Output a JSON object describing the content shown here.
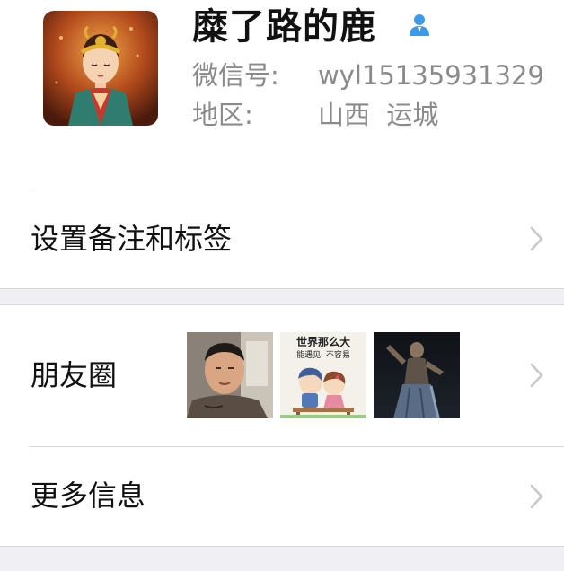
{
  "profile": {
    "name": "糜了路的鹿",
    "wechat_id_label": "微信号:",
    "wechat_id": "wyl15135931329",
    "region_label": "地区:",
    "region": "山西  运城",
    "avatar_icon": "avatar-monkey-king-child",
    "gender_icon": "person-icon"
  },
  "cells": {
    "remark_label": "设置备注和标签",
    "moments_label": "朋友圈",
    "more_label": "更多信息"
  },
  "moments": {
    "photo2_caption_line1": "世界那么大",
    "photo2_caption_line2": "能遇见, 不容易"
  },
  "colors": {
    "accent_blue": "#3d9ae8",
    "secondary_text": "#8a8a8a",
    "separator": "#d9d9d9",
    "background_gray": "#efeff4"
  }
}
